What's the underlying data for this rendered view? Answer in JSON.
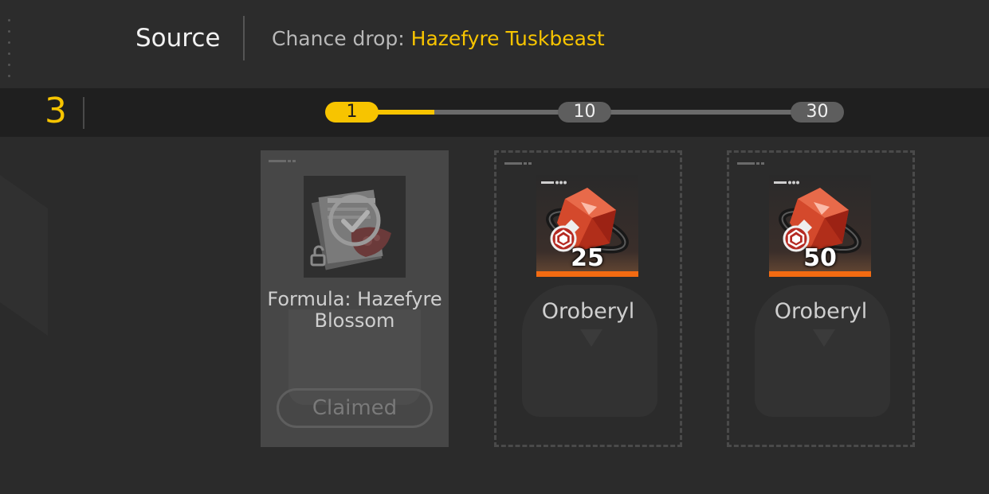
{
  "header": {
    "title": "Source",
    "chance_prefix": "Chance drop: ",
    "chance_target": "Hazefyre Tuskbeast"
  },
  "progress": {
    "current_level": "3",
    "milestones": [
      "1",
      "10",
      "30"
    ],
    "active_milestone": "1"
  },
  "rewards": [
    {
      "name": "Formula: Hazefyre Blossom",
      "status": "Claimed",
      "claimed": true,
      "icon": "formula-scroll-icon"
    },
    {
      "name": "Oroberyl",
      "count": "25",
      "claimed": false,
      "icon": "oroberyl-crystal-icon",
      "rarity_color": "#f36b12"
    },
    {
      "name": "Oroberyl",
      "count": "50",
      "claimed": false,
      "icon": "oroberyl-crystal-icon",
      "rarity_color": "#f36b12"
    }
  ],
  "colors": {
    "accent": "#f7c400",
    "background": "#2b2b2b",
    "rarity_orange": "#f36b12"
  }
}
